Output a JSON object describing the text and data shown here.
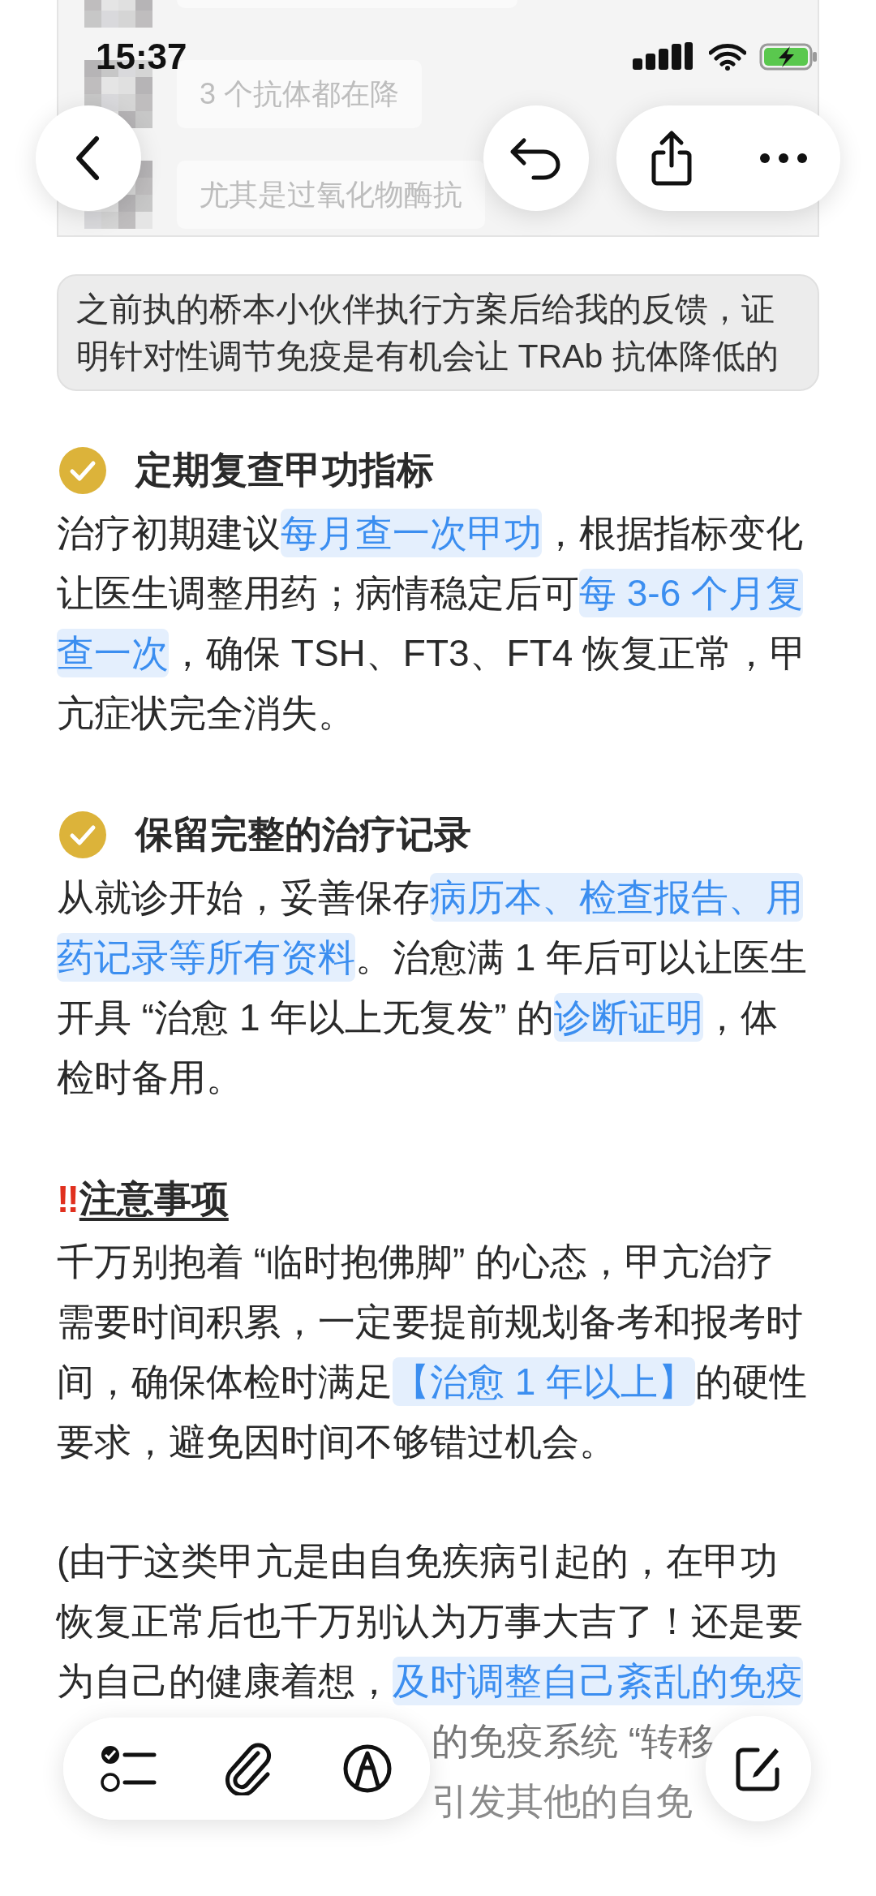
{
  "status_bar": {
    "time": "15:37"
  },
  "chat_screenshot": {
    "messages": [
      {
        "text": "3 个抗体都在降"
      },
      {
        "text": "尤其是过氧化物酶抗"
      }
    ]
  },
  "caption": "之前执的桥本小伙伴执行方案后给我的反馈，证明针对性调节免疫是有机会让 TRAb 抗体降低的",
  "sections": [
    {
      "kind": "checked",
      "heading": "定期复查甲功指标",
      "paragraph": [
        {
          "text": "治疗初期建议",
          "highlighted": false
        },
        {
          "text": "每月查一次甲功",
          "highlighted": true
        },
        {
          "text": "，根据指标变化让医生调整用药；病情稳定后可",
          "highlighted": false
        },
        {
          "text": "每 3-6 个月复查一次",
          "highlighted": true
        },
        {
          "text": "，确保 TSH、FT3、FT4 恢复正常，甲亢症状完全消失。",
          "highlighted": false
        }
      ]
    },
    {
      "kind": "checked",
      "heading": "保留完整的治疗记录",
      "paragraph": [
        {
          "text": "从就诊开始，妥善保存",
          "highlighted": false
        },
        {
          "text": "病历本、检查报告、用药记录等所有资料",
          "highlighted": true
        },
        {
          "text": "。治愈满 1 年后可以让医生开具 “治愈 1 年以上无复发” 的",
          "highlighted": false
        },
        {
          "text": "诊断证明",
          "highlighted": true
        },
        {
          "text": "，体检时备用。",
          "highlighted": false
        }
      ]
    },
    {
      "kind": "warning",
      "icon": "‼",
      "heading": "注意事项",
      "paragraph": [
        {
          "text": "千万别抱着 “临时抱佛脚” 的心态，甲亢治疗需要时间积累，一定要提前规划备考和报考时间，确保体检时满足",
          "highlighted": false
        },
        {
          "text": "【治愈 1 年以上】",
          "highlighted": true
        },
        {
          "text": "的硬性要求，避免因时间不够错过机会。",
          "highlighted": false
        }
      ]
    },
    {
      "kind": "plain",
      "paragraph": [
        {
          "text": "(由于这类甲亢是由自免疾病引起的，在甲功恢复正常后也千万别认为万事大吉了！还是要为自己的健康着想，",
          "highlighted": false
        },
        {
          "text": "及时调整自己紊乱的免疫",
          "highlighted": true
        }
      ],
      "continuation": [
        "的免疫系统 “转移",
        "引发其他的自免"
      ]
    }
  ]
}
